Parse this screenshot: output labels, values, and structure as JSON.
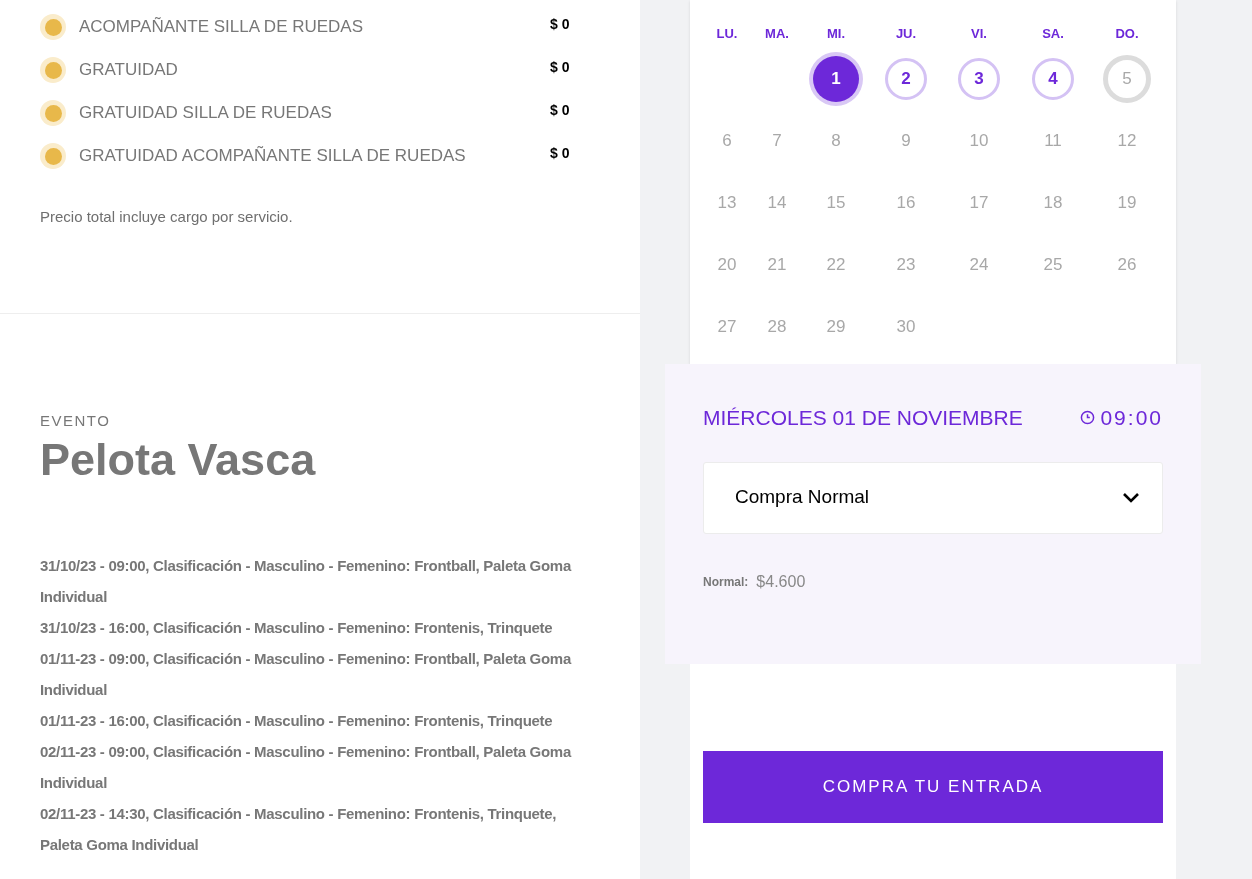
{
  "ticket_types": [
    {
      "name": "ACOMPAÑANTE SILLA DE RUEDAS",
      "price": "$ 0",
      "color": "#e8b84a"
    },
    {
      "name": "GRATUIDAD",
      "price": "$ 0",
      "color": "#e8b84a"
    },
    {
      "name": "GRATUIDAD SILLA DE RUEDAS",
      "price": "$ 0",
      "color": "#e8b84a"
    },
    {
      "name": "GRATUIDAD ACOMPAÑANTE SILLA DE RUEDAS",
      "price": "$ 0",
      "color": "#e8b84a"
    }
  ],
  "price_note": "Precio total incluye cargo por servicio.",
  "event": {
    "label": "EVENTO",
    "title": "Pelota Vasca",
    "schedule": [
      "31/10/23 - 09:00, Clasificación - Masculino - Femenino: Frontball, Paleta Goma Individual",
      "31/10/23 - 16:00, Clasificación - Masculino - Femenino: Frontenis, Trinquete",
      "01/11-23 - 09:00, Clasificación - Masculino - Femenino: Frontball, Paleta Goma Individual",
      "01/11-23 - 16:00, Clasificación - Masculino - Femenino: Frontenis, Trinquete",
      "02/11-23 - 09:00, Clasificación - Masculino - Femenino: Frontball, Paleta Goma Individual",
      "02/11-23 - 14:30, Clasificación - Masculino - Femenino: Frontenis, Trinquete, Paleta Goma Individual"
    ]
  },
  "calendar": {
    "weekdays": [
      "LU.",
      "MA.",
      "MI.",
      "JU.",
      "VI.",
      "SA.",
      "DO."
    ],
    "weeks": [
      [
        {
          "day": "1",
          "kind": "available",
          "selected": true
        },
        {
          "day": "2",
          "kind": "available",
          "selected": false
        },
        {
          "day": "3",
          "kind": "available",
          "selected": false
        },
        {
          "day": "4",
          "kind": "available",
          "selected": false
        },
        {
          "day": "5",
          "kind": "full",
          "selected": false
        }
      ],
      [
        {
          "day": "6",
          "kind": "inactive",
          "selected": false
        },
        {
          "day": "7",
          "kind": "inactive",
          "selected": false
        },
        {
          "day": "8",
          "kind": "inactive",
          "selected": false
        },
        {
          "day": "9",
          "kind": "inactive",
          "selected": false
        },
        {
          "day": "10",
          "kind": "inactive",
          "selected": false
        },
        {
          "day": "11",
          "kind": "inactive",
          "selected": false
        },
        {
          "day": "12",
          "kind": "inactive",
          "selected": false
        }
      ],
      [
        {
          "day": "13",
          "kind": "inactive",
          "selected": false
        },
        {
          "day": "14",
          "kind": "inactive",
          "selected": false
        },
        {
          "day": "15",
          "kind": "inactive",
          "selected": false
        },
        {
          "day": "16",
          "kind": "inactive",
          "selected": false
        },
        {
          "day": "17",
          "kind": "inactive",
          "selected": false
        },
        {
          "day": "18",
          "kind": "inactive",
          "selected": false
        },
        {
          "day": "19",
          "kind": "inactive",
          "selected": false
        }
      ],
      [
        {
          "day": "20",
          "kind": "inactive",
          "selected": false
        },
        {
          "day": "21",
          "kind": "inactive",
          "selected": false
        },
        {
          "day": "22",
          "kind": "inactive",
          "selected": false
        },
        {
          "day": "23",
          "kind": "inactive",
          "selected": false
        },
        {
          "day": "24",
          "kind": "inactive",
          "selected": false
        },
        {
          "day": "25",
          "kind": "inactive",
          "selected": false
        },
        {
          "day": "26",
          "kind": "inactive",
          "selected": false
        }
      ],
      [
        {
          "day": "27",
          "kind": "inactive",
          "selected": false
        },
        {
          "day": "28",
          "kind": "inactive",
          "selected": false
        },
        {
          "day": "29",
          "kind": "inactive",
          "selected": false
        },
        {
          "day": "30",
          "kind": "inactive",
          "selected": false
        }
      ]
    ]
  },
  "booking": {
    "date": "MIÉRCOLES 01 DE NOVIEMBRE",
    "time": "09:00",
    "purchase_type": "Compra Normal",
    "price_label": "Normal:",
    "price": "$4.600",
    "button": "COMPRA TU ENTRADA"
  }
}
